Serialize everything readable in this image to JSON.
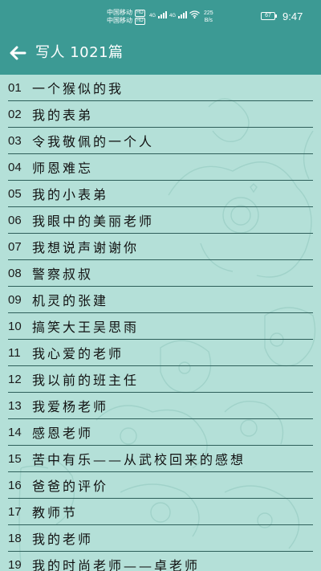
{
  "status_bar": {
    "carrier_1": "中国移动",
    "carrier_2": "中国移动",
    "hd_badge": "HD",
    "network_1": "4G",
    "network_2": "4G",
    "speed_value": "225",
    "speed_unit": "B/s",
    "battery": "67",
    "time": "9:47"
  },
  "header": {
    "title": "写人 1021篇",
    "back_icon": "arrow-left-icon"
  },
  "colors": {
    "header_bg": "#3c9a94",
    "list_bg": "#b4e0d8",
    "divider": "#2e5f5a"
  },
  "items": [
    {
      "num": "01",
      "title": "一个猴似的我"
    },
    {
      "num": "02",
      "title": "我的表弟"
    },
    {
      "num": "03",
      "title": "令我敬佩的一个人"
    },
    {
      "num": "04",
      "title": "师恩难忘"
    },
    {
      "num": "05",
      "title": "我的小表弟"
    },
    {
      "num": "06",
      "title": "我眼中的美丽老师"
    },
    {
      "num": "07",
      "title": "我想说声谢谢你"
    },
    {
      "num": "08",
      "title": "警察叔叔"
    },
    {
      "num": "09",
      "title": "机灵的张建"
    },
    {
      "num": "10",
      "title": "搞笑大王吴思雨"
    },
    {
      "num": "11",
      "title": "我心爱的老师"
    },
    {
      "num": "12",
      "title": "我以前的班主任"
    },
    {
      "num": "13",
      "title": "我爱杨老师"
    },
    {
      "num": "14",
      "title": "感恩老师"
    },
    {
      "num": "15",
      "title": "苦中有乐——从武校回来的感想"
    },
    {
      "num": "16",
      "title": "爸爸的评价"
    },
    {
      "num": "17",
      "title": "教师节"
    },
    {
      "num": "18",
      "title": "我的老师"
    },
    {
      "num": "19",
      "title": "我的时尚老师——卓老师"
    }
  ]
}
